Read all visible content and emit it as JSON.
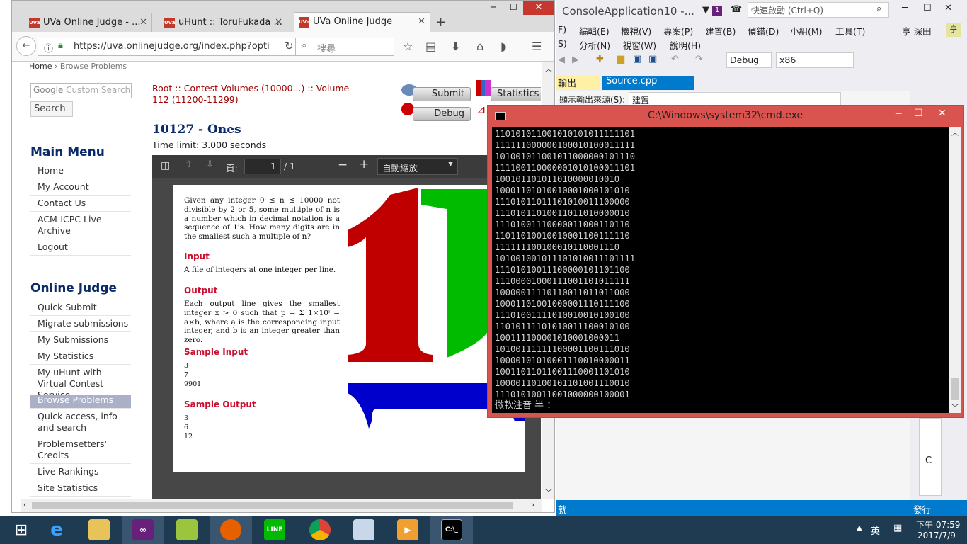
{
  "firefox": {
    "tabs": [
      {
        "label": "UVa Online Judge - ...",
        "icon": "UVa"
      },
      {
        "label": "uHunt :: ToruFukada ...",
        "icon": "UVa"
      },
      {
        "label": "UVa Online Judge",
        "icon": "UVa"
      }
    ],
    "url": "https://uva.onlinejudge.org/index.php?optio",
    "search_placeholder": "搜尋",
    "breadcrumb": {
      "home": "Home",
      "current": "Browse Problems"
    },
    "site_search_placeholder": "Custom Search",
    "site_search_button": "Search",
    "main_menu_title": "Main Menu",
    "main_menu": [
      "Home",
      "My Account",
      "Contact Us",
      "ACM-ICPC Live Archive",
      "Logout"
    ],
    "oj_title": "Online Judge",
    "oj_menu": [
      "Quick Submit",
      "Migrate submissions",
      "My Submissions",
      "My Statistics",
      "My uHunt with Virtual Contest Service",
      "Browse Problems",
      "Quick access, info and search",
      "Problemsetters' Credits",
      "Live Rankings",
      "Site Statistics"
    ],
    "selected_menu": "Browse Problems",
    "problem_path": "Root :: Contest Volumes (10000...) :: Volume 112 (11200-11299)",
    "problem_title": "10127 - Ones",
    "time_limit": "Time limit: 3.000 seconds",
    "buttons": {
      "submit": "Submit",
      "debug": "Debug",
      "statistics": "Statistics"
    },
    "pdf": {
      "page_label": "頁:",
      "page_value": "1",
      "page_total": "/ 1",
      "zoom": "自動縮放",
      "intro": "Given any integer 0 ≤ n ≤ 10000 not divisible by 2 or 5, some multiple of n is a number which in decimal notation is a sequence of 1's. How many digits are in the smallest such a multiple of n?",
      "input_h": "Input",
      "input_t": "A file of integers at one integer per line.",
      "output_h": "Output",
      "output_t": "Each output line gives the smallest integer x > 0 such that p = Σ 1×10ⁱ = a×b, where a is the corresponding input integer, and b is an integer greater than zero.",
      "sample_in_h": "Sample Input",
      "sample_in": [
        "3",
        "7",
        "9901"
      ],
      "sample_out_h": "Sample Output",
      "sample_out": [
        "3",
        "6",
        "12"
      ]
    }
  },
  "vs": {
    "title": "ConsoleApplication10 -...",
    "quick_launch": "快速啟動 (Ctrl+Q)",
    "user": "亨 深田",
    "menus": [
      "F)",
      "編輯(E)",
      "檢視(V)",
      "專案(P)",
      "建置(B)",
      "偵錯(D)",
      "小組(M)",
      "工具(T)",
      "S)",
      "分析(N)",
      "視窗(W)",
      "說明(H)"
    ],
    "config": "Debug",
    "platform": "x86",
    "tabs": [
      "輸出",
      "Source.cpp"
    ],
    "output_source_label": "顯示輸出來源(S):",
    "output_source": "建置",
    "status_left": "就",
    "status_right": "發行",
    "side_letter": "C"
  },
  "cmd": {
    "title": "C:\\Windows\\system32\\cmd.exe",
    "lines": [
      "110101011001010101011111101",
      "111111000000100010100011111",
      "101001011001011000000101110",
      "111100110000001010100011101",
      "100101101011010000010010",
      "10001101010010001000101010",
      "11101011011101010011100000",
      "11101011010011011010000010",
      "11101001110000011000110110",
      "11011010010010001100111110",
      "111111100100010110001110",
      "101001001011101010011101111",
      "11101010011100000101101100",
      "11100001000111001101011111",
      "10000011110110011011011000",
      "10001101001000001110111100",
      "11101001111010010010100100",
      "11010111101010011100010100",
      "100111100001010001000011",
      "10100111111100001100111010",
      "10000101010001110010000011",
      "10011011011001110001101010",
      "10000110100101101001110010",
      "11101010011001000000100001"
    ],
    "ime": "微軟注音 半 ："
  },
  "taskbar": {
    "ime": "英",
    "time": "下午 07:59",
    "date": "2017/7/9"
  }
}
